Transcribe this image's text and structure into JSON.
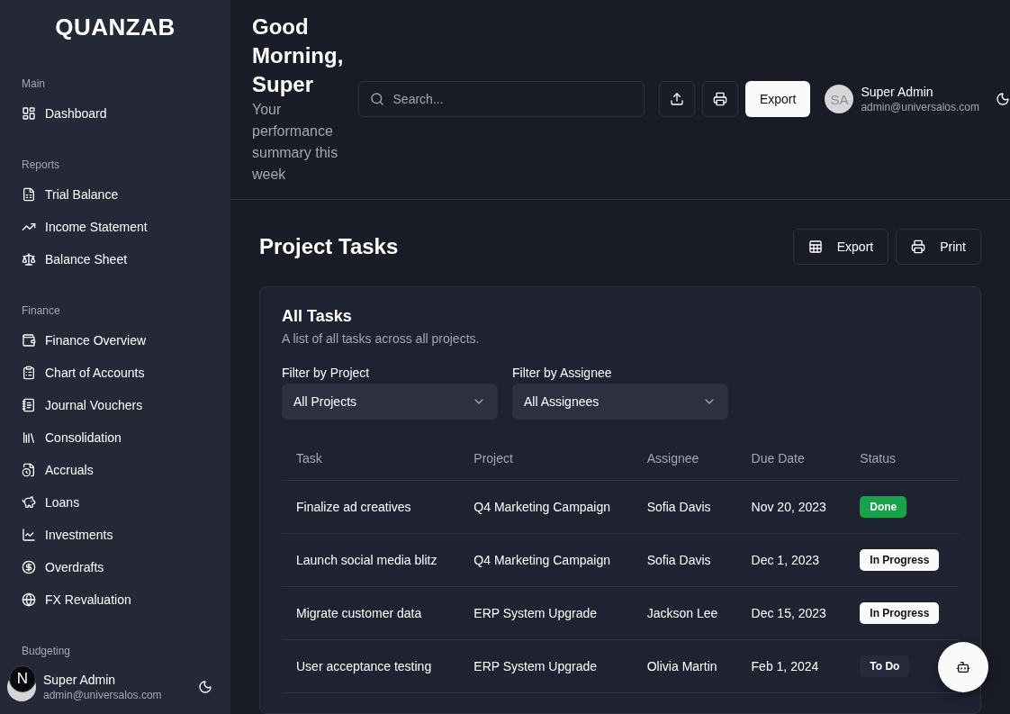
{
  "sidebar": {
    "logo": "QUANZAB",
    "sections": [
      {
        "title": "Main",
        "items": [
          {
            "label": "Dashboard"
          }
        ]
      },
      {
        "title": "Reports",
        "items": [
          {
            "label": "Trial Balance"
          },
          {
            "label": "Income Statement"
          },
          {
            "label": "Balance Sheet"
          }
        ]
      },
      {
        "title": "Finance",
        "items": [
          {
            "label": "Finance Overview"
          },
          {
            "label": "Chart of Accounts"
          },
          {
            "label": "Journal Vouchers"
          },
          {
            "label": "Consolidation"
          },
          {
            "label": "Accruals"
          },
          {
            "label": "Loans"
          },
          {
            "label": "Investments"
          },
          {
            "label": "Overdrafts"
          },
          {
            "label": "FX Revaluation"
          }
        ]
      },
      {
        "title": "Budgeting"
      }
    ],
    "user": {
      "name": "Super Admin",
      "email": "admin@universalos.com"
    },
    "dev_badge": "N"
  },
  "header": {
    "greeting": "Good Morning, Super",
    "subtitle": "Your performance summary this week",
    "search": {
      "placeholder": "Search..."
    },
    "export_button": "Export",
    "user": {
      "initials": "SA",
      "name": "Super Admin",
      "email": "admin@universalos.com"
    }
  },
  "page": {
    "title": "Project Tasks",
    "actions": [
      {
        "label": "Export"
      },
      {
        "label": "Print"
      }
    ]
  },
  "card": {
    "title": "All Tasks",
    "description": "A list of all tasks across all projects.",
    "filters": [
      {
        "label": "Filter by Project",
        "value": "All Projects"
      },
      {
        "label": "Filter by Assignee",
        "value": "All Assignees"
      }
    ],
    "table": {
      "columns": [
        "Task",
        "Project",
        "Assignee",
        "Due Date",
        "Status"
      ],
      "rows": [
        {
          "task": "Finalize ad creatives",
          "project": "Q4 Marketing Campaign",
          "assignee": "Sofia Davis",
          "due": "Nov 20, 2023",
          "status": {
            "label": "Done",
            "kind": "done"
          }
        },
        {
          "task": "Launch social media blitz",
          "project": "Q4 Marketing Campaign",
          "assignee": "Sofia Davis",
          "due": "Dec 1, 2023",
          "status": {
            "label": "In Progress",
            "kind": "progress"
          }
        },
        {
          "task": "Migrate customer data",
          "project": "ERP System Upgrade",
          "assignee": "Jackson Lee",
          "due": "Dec 15, 2023",
          "status": {
            "label": "In Progress",
            "kind": "progress"
          }
        },
        {
          "task": "User acceptance testing",
          "project": "ERP System Upgrade",
          "assignee": "Olivia Martin",
          "due": "Feb 1, 2024",
          "status": {
            "label": "To Do",
            "kind": "todo"
          }
        }
      ]
    }
  }
}
